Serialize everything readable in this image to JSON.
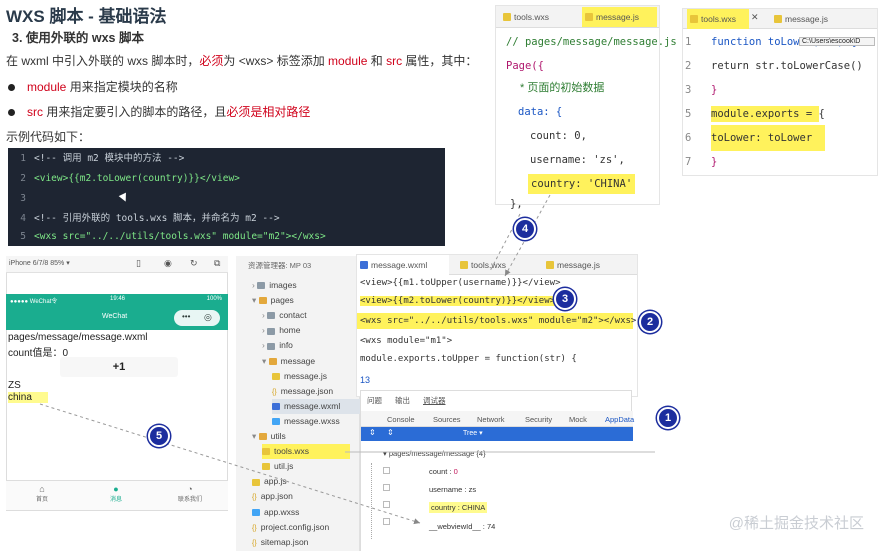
{
  "header": {
    "title": "WXS 脚本 - 基础语法",
    "subtitle": "3. 使用外联的 wxs 脚本",
    "intro_a": "在 wxml 中引入外联的 wxs 脚本时，",
    "intro_b": "必须",
    "intro_c": "为 <wxs> 标签添加 ",
    "intro_d": "module",
    "intro_e": " 和 ",
    "intro_f": "src",
    "intro_g": " 属性，其中：",
    "bullet1_a": "module",
    "bullet1_b": " 用来指定模块的名称",
    "bullet2_a": "src",
    "bullet2_b": " 用来指定要引入的脚本的路径，且",
    "bullet2_c": "必须是相对路径",
    "example_label": "示例代码如下："
  },
  "dark_code": [
    {
      "n": "1",
      "text": "<!-- 调用 m2 模块中的方法 -->"
    },
    {
      "n": "2",
      "text": "<view>{{m2.toLower(country)}}</view>"
    },
    {
      "n": "3",
      "text": ""
    },
    {
      "n": "4",
      "text": "<!-- 引用外联的 tools.wxs 脚本，并命名为 m2 -->"
    },
    {
      "n": "5",
      "text": "<wxs src=\"../../utils/tools.wxs\" module=\"m2\"></wxs>"
    }
  ],
  "phone": {
    "model": "iPhone 6/7/8 85% ▾",
    "carrier": "●●●●● WeChat令",
    "time": "19:46",
    "battery": "100%",
    "nav_title": "WeChat",
    "path": "pages/message/message.wxml",
    "count_line": "count值是：0",
    "plus_label": "+1",
    "upper_value": "ZS",
    "lower_value": "china",
    "tabs": [
      "首页",
      "消息",
      "联系我们"
    ]
  },
  "explorer": {
    "header": "资源管理器: MP 03",
    "items": [
      {
        "label": "images",
        "kind": "folder",
        "depth": 1
      },
      {
        "label": "pages",
        "kind": "folder-o",
        "depth": 1
      },
      {
        "label": "contact",
        "kind": "folder",
        "depth": 2
      },
      {
        "label": "home",
        "kind": "folder",
        "depth": 2
      },
      {
        "label": "info",
        "kind": "folder",
        "depth": 2
      },
      {
        "label": "message",
        "kind": "folder-o",
        "depth": 2
      },
      {
        "label": "message.js",
        "kind": "js",
        "depth": 3
      },
      {
        "label": "message.json",
        "kind": "json",
        "depth": 3
      },
      {
        "label": "message.wxml",
        "kind": "wxml",
        "depth": 3
      },
      {
        "label": "message.wxss",
        "kind": "wxss",
        "depth": 3
      },
      {
        "label": "utils",
        "kind": "folder-o",
        "depth": 1
      },
      {
        "label": "tools.wxs",
        "kind": "wxs",
        "depth": 2
      },
      {
        "label": "util.js",
        "kind": "js",
        "depth": 2
      },
      {
        "label": "app.js",
        "kind": "js",
        "depth": 1
      },
      {
        "label": "app.json",
        "kind": "json",
        "depth": 1
      },
      {
        "label": "app.wxss",
        "kind": "wxss",
        "depth": 1
      },
      {
        "label": "project.config.json",
        "kind": "json",
        "depth": 1
      },
      {
        "label": "sitemap.json",
        "kind": "json",
        "depth": 1
      }
    ]
  },
  "editor_bottom": {
    "tabs": [
      "message.wxml",
      "tools.wxs",
      "message.js"
    ],
    "line1": "<view>{{m1.toUpper(username)}}</view>",
    "line2": "<view>{{m2.toLower(country)}}</view>",
    "line3": "<wxs src=\"../../utils/tools.wxs\" module=\"m2\"></wxs>",
    "line4": "<wxs module=\"m1\">",
    "line5": "  module.exports.toUpper = function(str) {",
    "line_num": "13"
  },
  "devtools": {
    "panel_tabs": [
      "问题",
      "输出",
      "调试器"
    ],
    "tabs": [
      "Console",
      "Sources",
      "Network",
      "Security",
      "Mock",
      "AppData"
    ],
    "mode": "Tree ▾",
    "root": "pages/message/message {4}",
    "props": [
      {
        "key": "count",
        "value": "0"
      },
      {
        "key": "username",
        "value": "zs"
      },
      {
        "key": "country",
        "value": "CHINA"
      },
      {
        "key": "__webviewId__",
        "value": "74"
      }
    ]
  },
  "editor_top_mid": {
    "tabs": [
      "tools.wxs",
      "message.js"
    ],
    "comment": "// pages/message/message.js",
    "page_open": "Page({",
    "doc_comment": "* 页面的初始数据",
    "data_label": "data: {",
    "count": "count: 0,",
    "username": "username: 'zs',",
    "country": "country: 'CHINA'",
    "close": "},"
  },
  "editor_top_right": {
    "tabs": [
      "tools.wxs",
      "message.js"
    ],
    "tooltip": "C:\\Users\\escook\\D",
    "lines": [
      {
        "n": "1",
        "text": "function toLower(str) {"
      },
      {
        "n": "2",
        "text": "  return str.toLowerCase()"
      },
      {
        "n": "3",
        "text": "}"
      },
      {
        "n": "5",
        "text": "module.exports = {"
      },
      {
        "n": "6",
        "text": "  toLower: toLower"
      },
      {
        "n": "7",
        "text": "}"
      }
    ]
  },
  "callouts": [
    "1",
    "2",
    "3",
    "4",
    "5"
  ],
  "watermark": "@稀土掘金技术社区",
  "colors": {
    "callout": "#1c2d9e",
    "highlight": "#fff25c",
    "accent_red": "#d0021b",
    "wechat_green": "#1aad8f"
  }
}
